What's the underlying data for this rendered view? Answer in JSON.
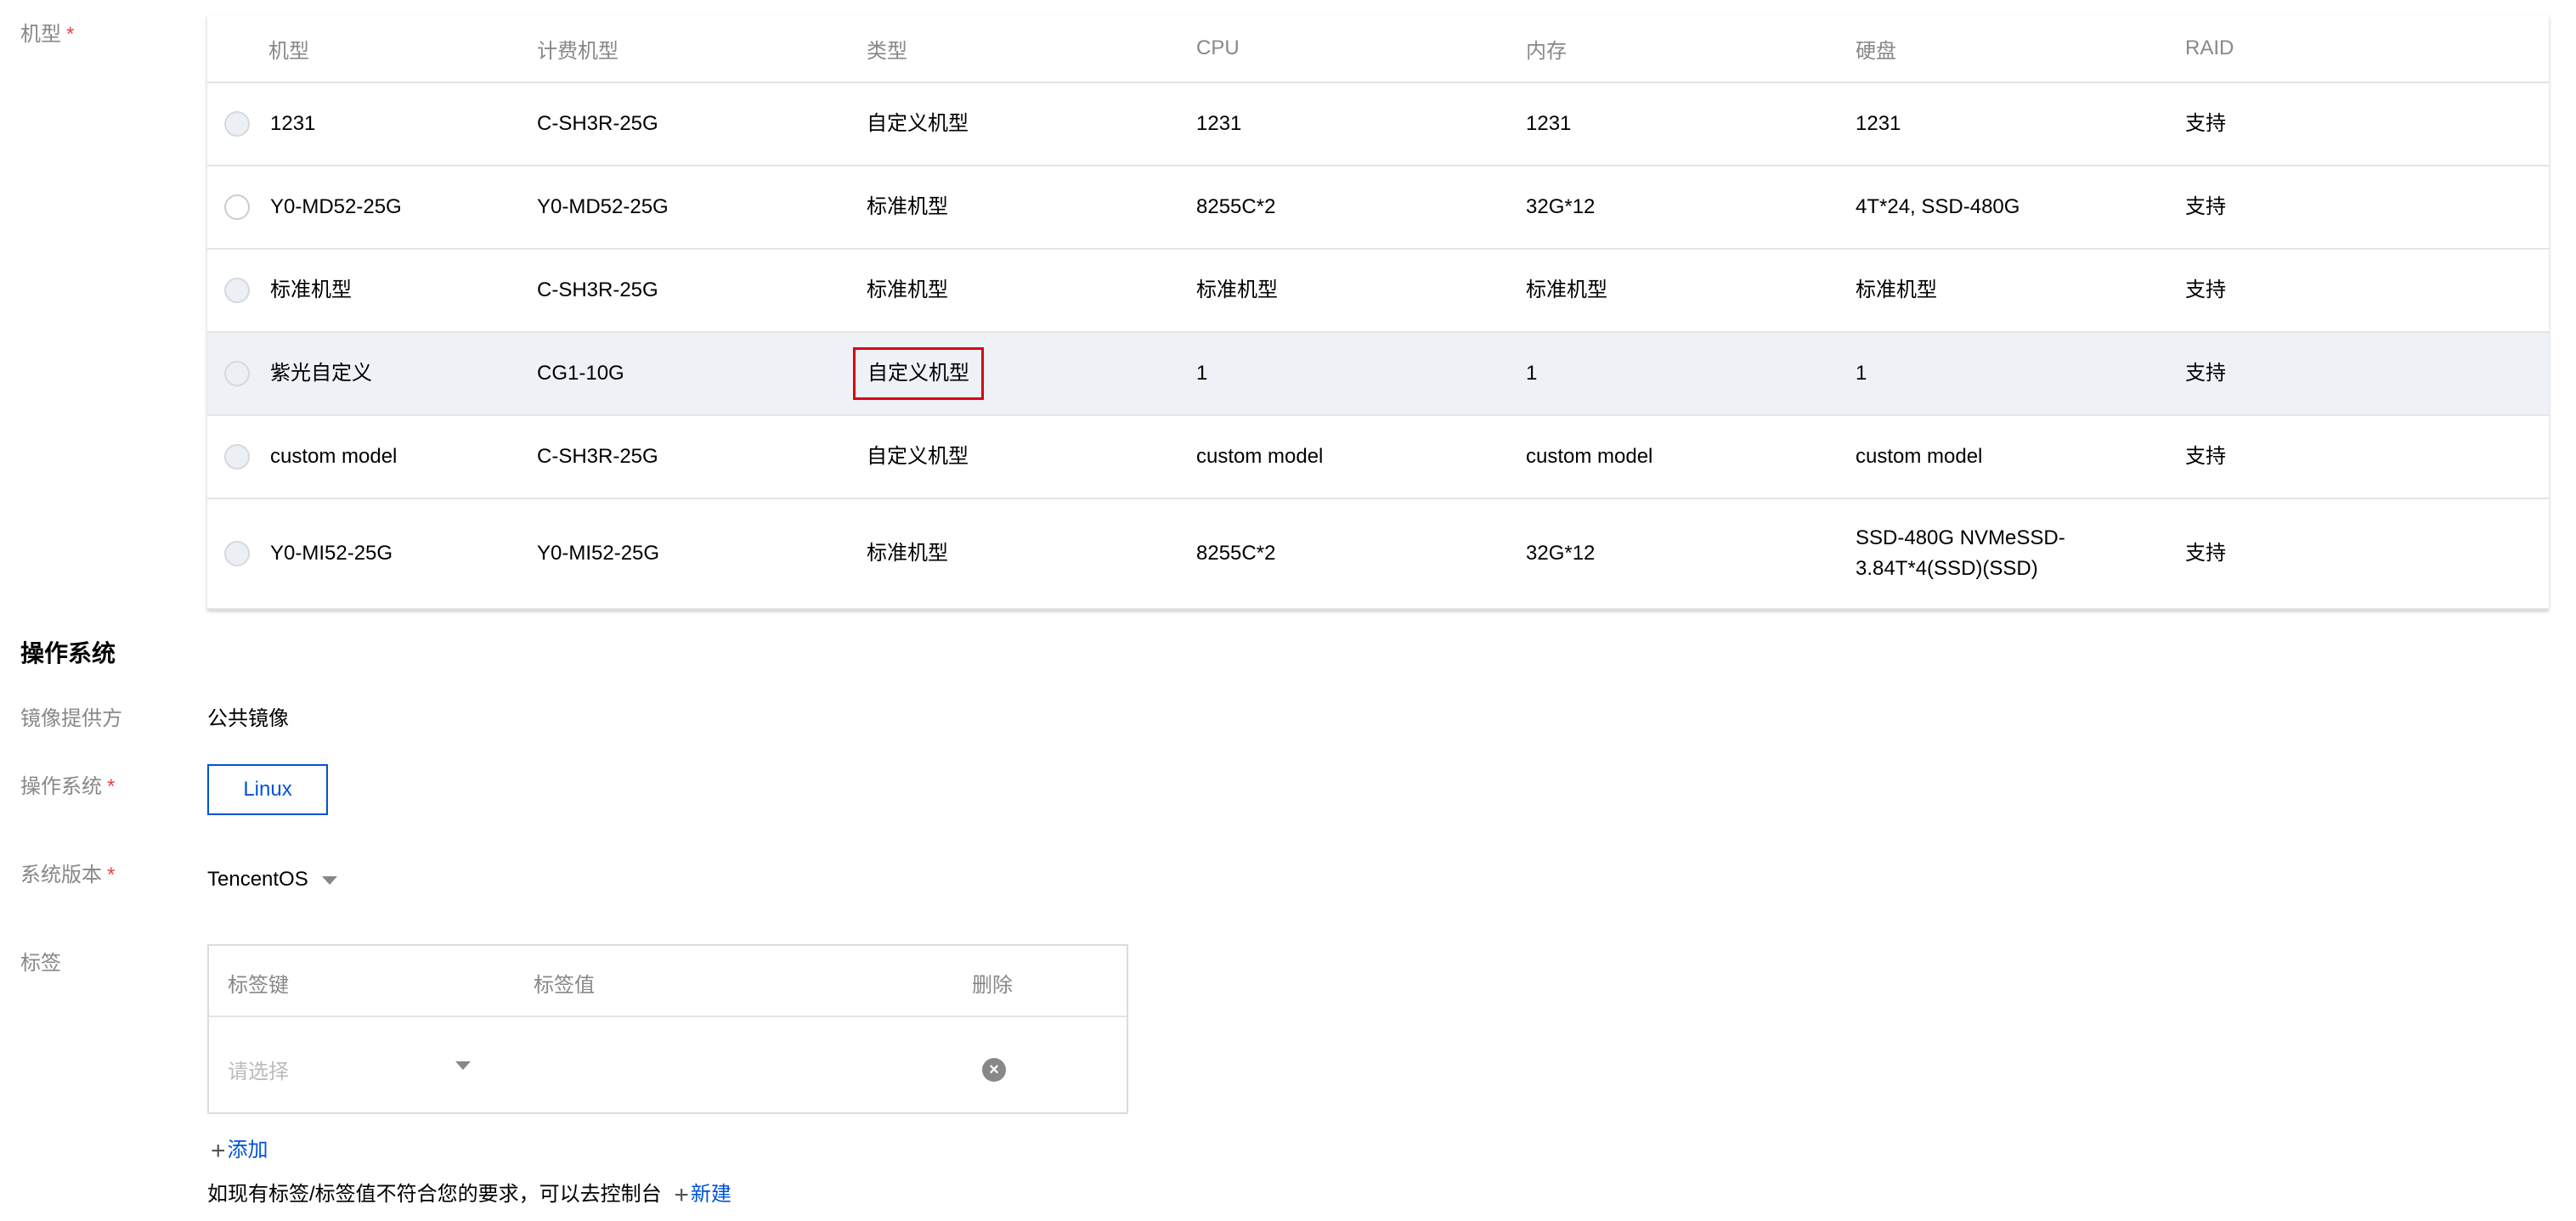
{
  "machine": {
    "label": "机型",
    "required": "*",
    "columns": [
      "机型",
      "计费机型",
      "类型",
      "CPU",
      "内存",
      "硬盘",
      "RAID"
    ],
    "rows": [
      [
        "1231",
        "C-SH3R-25G",
        "自定义机型",
        "1231",
        "1231",
        "1231",
        "支持"
      ],
      [
        "Y0-MD52-25G",
        "Y0-MD52-25G",
        "标准机型",
        "8255C*2",
        "32G*12",
        "4T*24, SSD-480G",
        "支持"
      ],
      [
        "标准机型",
        "C-SH3R-25G",
        "标准机型",
        "标准机型",
        "标准机型",
        "标准机型",
        "支持"
      ],
      [
        "紫光自定义",
        "CG1-10G",
        "自定义机型",
        "1",
        "1",
        "1",
        "支持"
      ],
      [
        "custom model",
        "C-SH3R-25G",
        "自定义机型",
        "custom model",
        "custom model",
        "custom model",
        "支持"
      ],
      [
        "Y0-MI52-25G",
        "Y0-MI52-25G",
        "标准机型",
        "8255C*2",
        "32G*12",
        "SSD-480G NVMeSSD-3.84T*4(SSD)(SSD)",
        "支持"
      ]
    ]
  },
  "os": {
    "section_title": "操作系统",
    "provider_label": "镜像提供方",
    "provider_value": "公共镜像",
    "os_label": "操作系统",
    "os_value": "Linux",
    "version_label": "系统版本",
    "version_value": "TencentOS",
    "required": "*"
  },
  "tags": {
    "label": "标签",
    "columns": {
      "key": "标签键",
      "value": "标签值",
      "delete": "删除"
    },
    "key_placeholder": "请选择",
    "add_label": "添加",
    "hint": "如现有标签/标签值不符合您的要求，可以去控制台",
    "new_label": "新建"
  },
  "icons": {
    "delete": "close-circle-icon",
    "add": "plus-icon",
    "dropdown": "caret-down-icon"
  },
  "colors": {
    "accent": "#0052d9",
    "highlight_border": "#d9001b",
    "required": "#e54545"
  }
}
